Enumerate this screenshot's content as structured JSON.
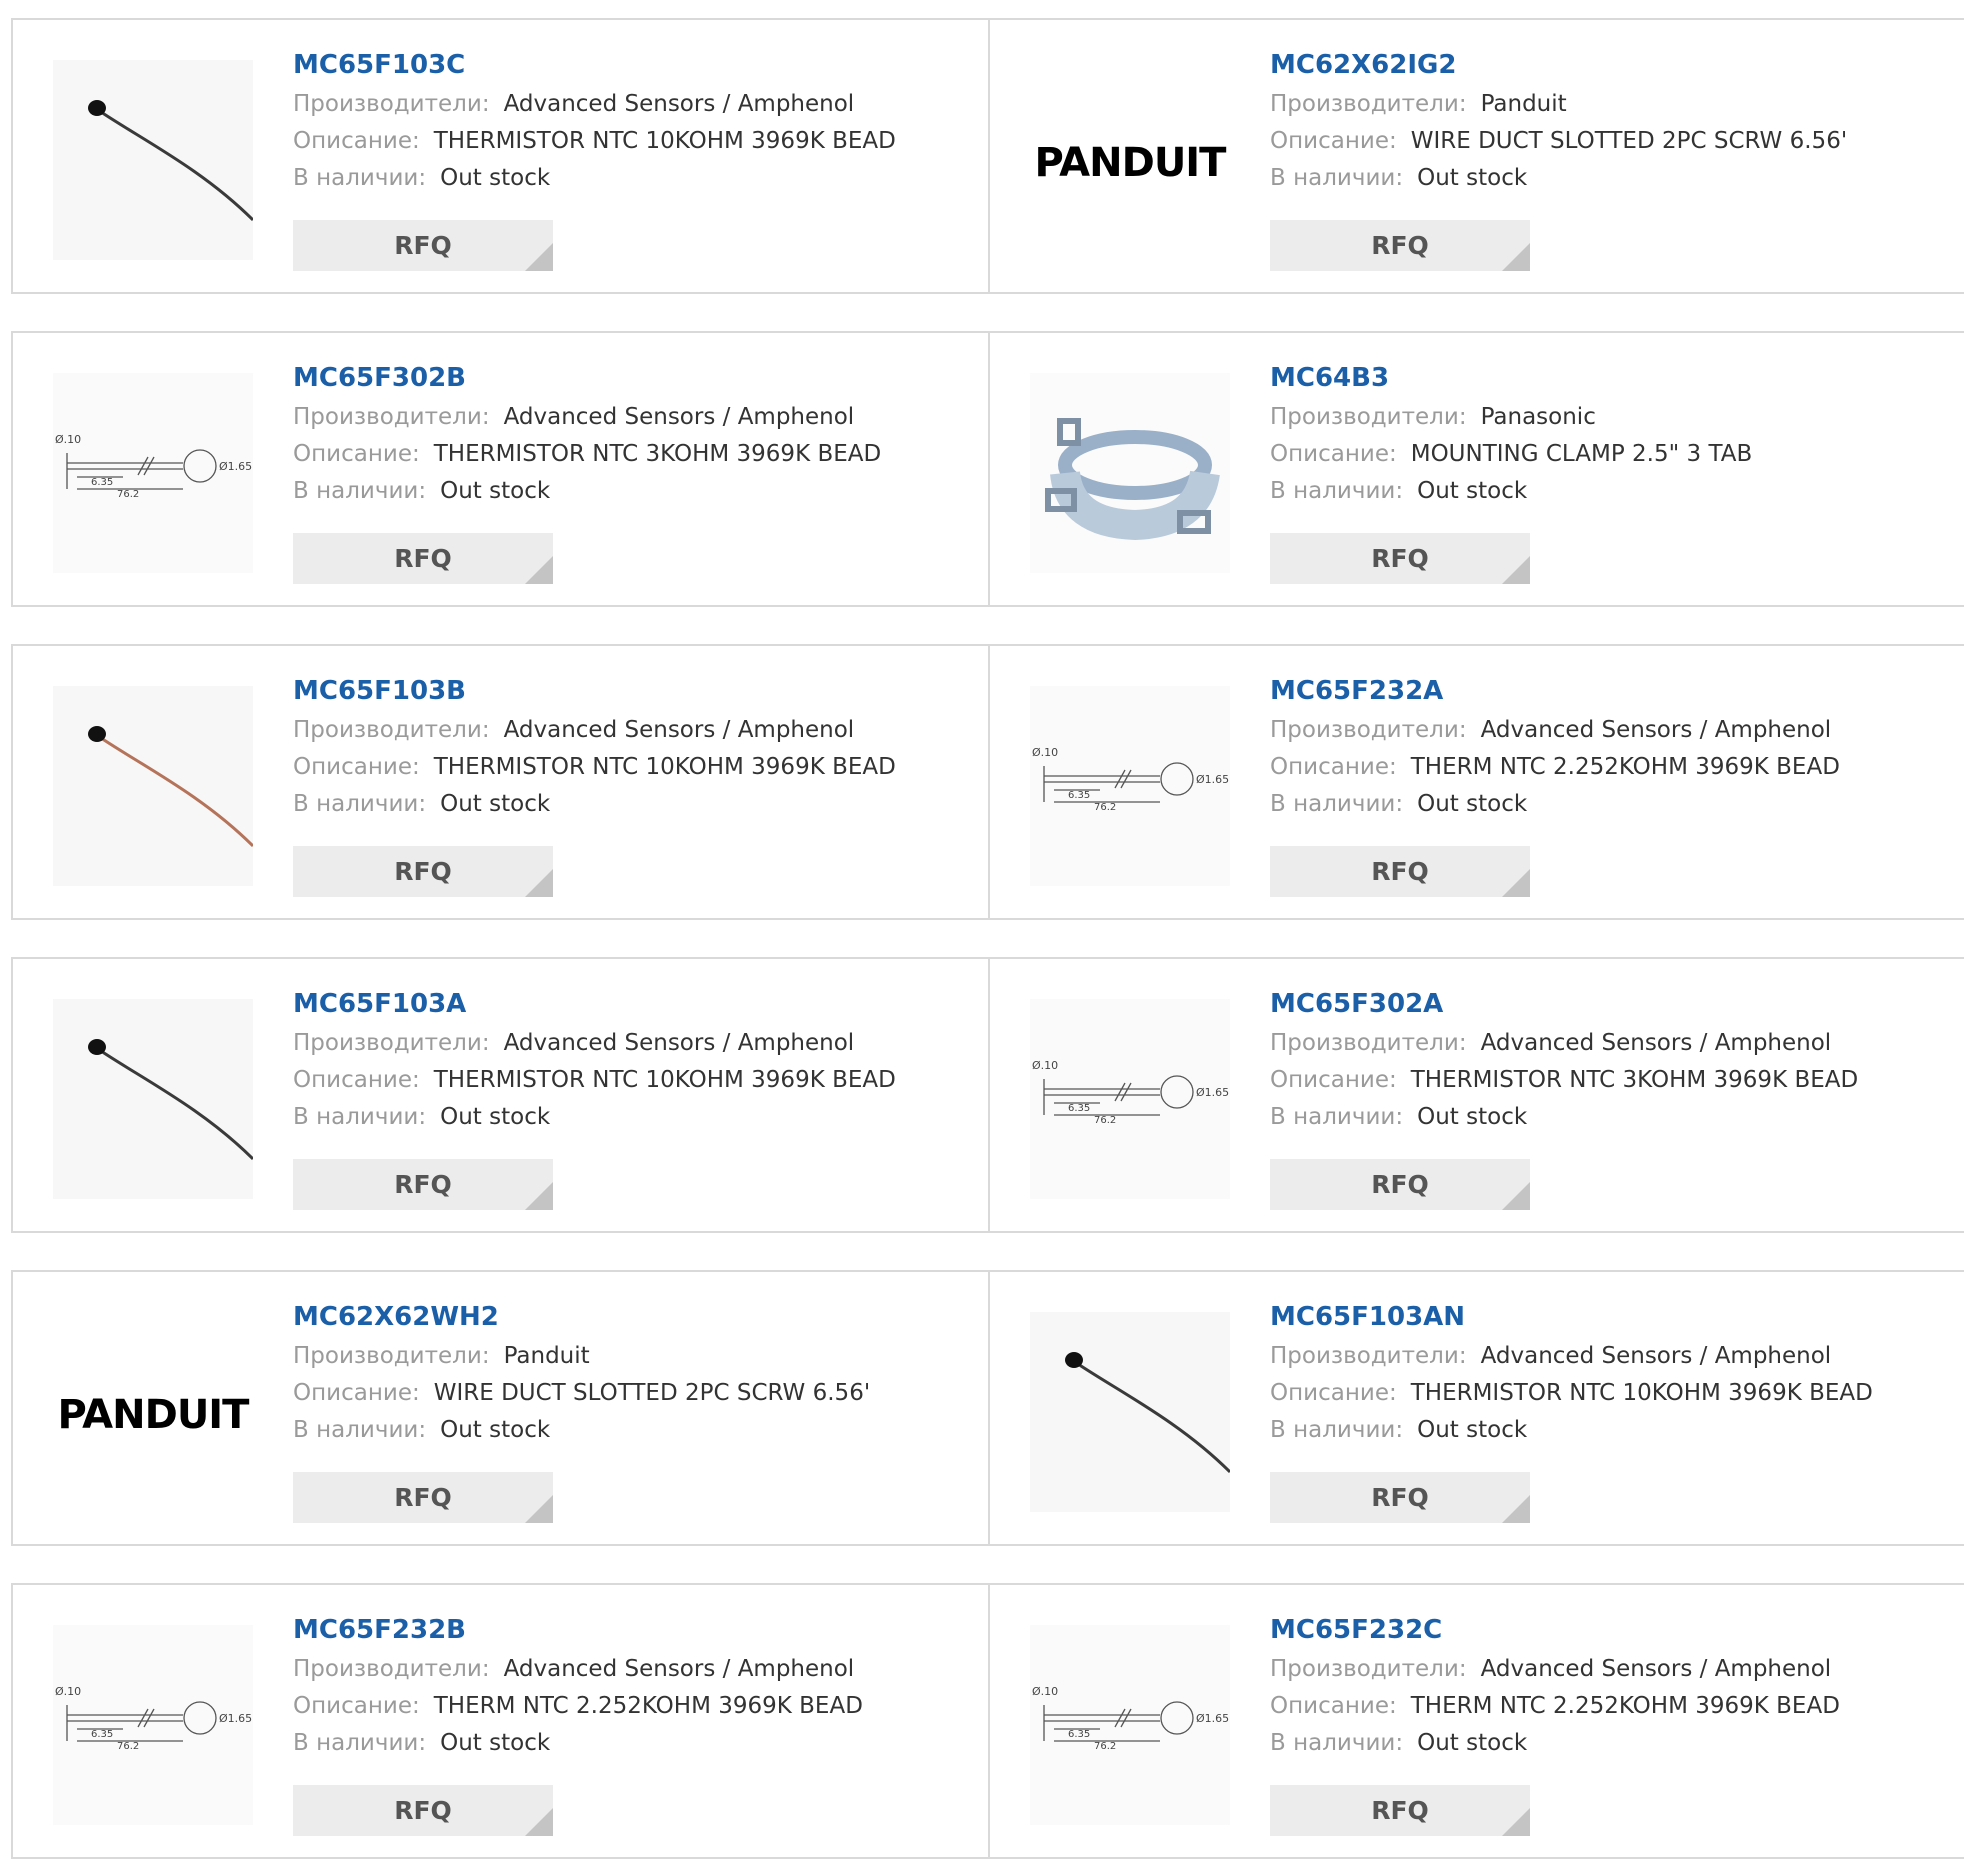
{
  "labels": {
    "manufacturer": "Производители:",
    "description": "Описание:",
    "stock": "В наличии:"
  },
  "rfq_label": "RFQ",
  "products": [
    {
      "pn": "MC65F103C",
      "manufacturer": "Advanced Sensors / Amphenol",
      "description": "THERMISTOR NTC 10KOHM 3969K BEAD",
      "stock": "Out stock",
      "image": "black-bead"
    },
    {
      "pn": "MC62X62IG2",
      "manufacturer": "Panduit",
      "description": "WIRE DUCT SLOTTED 2PC SCRW 6.56'",
      "stock": "Out stock",
      "image": "panduit-logo",
      "logo_text": "PANDUIT"
    },
    {
      "pn": "MC65F302B",
      "manufacturer": "Advanced Sensors / Amphenol",
      "description": "THERMISTOR NTC 3KOHM 3969K BEAD",
      "stock": "Out stock",
      "image": "diagram"
    },
    {
      "pn": "MC64B3",
      "manufacturer": "Panasonic",
      "description": "MOUNTING CLAMP 2.5\" 3 TAB",
      "stock": "Out stock",
      "image": "clamp"
    },
    {
      "pn": "MC65F103B",
      "manufacturer": "Advanced Sensors / Amphenol",
      "description": "THERMISTOR NTC 10KOHM 3969K BEAD",
      "stock": "Out stock",
      "image": "copper-bead"
    },
    {
      "pn": "MC65F232A",
      "manufacturer": "Advanced Sensors / Amphenol",
      "description": "THERM NTC 2.252KOHM 3969K BEAD",
      "stock": "Out stock",
      "image": "diagram"
    },
    {
      "pn": "MC65F103A",
      "manufacturer": "Advanced Sensors / Amphenol",
      "description": "THERMISTOR NTC 10KOHM 3969K BEAD",
      "stock": "Out stock",
      "image": "black-bead"
    },
    {
      "pn": "MC65F302A",
      "manufacturer": "Advanced Sensors / Amphenol",
      "description": "THERMISTOR NTC 3KOHM 3969K BEAD",
      "stock": "Out stock",
      "image": "diagram"
    },
    {
      "pn": "MC62X62WH2",
      "manufacturer": "Panduit",
      "description": "WIRE DUCT SLOTTED 2PC SCRW 6.56'",
      "stock": "Out stock",
      "image": "panduit-logo",
      "logo_text": "PANDUIT"
    },
    {
      "pn": "MC65F103AN",
      "manufacturer": "Advanced Sensors / Amphenol",
      "description": "THERMISTOR NTC 10KOHM 3969K BEAD",
      "stock": "Out stock",
      "image": "black-bead"
    },
    {
      "pn": "MC65F232B",
      "manufacturer": "Advanced Sensors / Amphenol",
      "description": "THERM NTC 2.252KOHM 3969K BEAD",
      "stock": "Out stock",
      "image": "diagram"
    },
    {
      "pn": "MC65F232C",
      "manufacturer": "Advanced Sensors / Amphenol",
      "description": "THERM NTC 2.252KOHM 3969K BEAD",
      "stock": "Out stock",
      "image": "diagram"
    }
  ],
  "diagram_text": {
    "d1": "Ø.10",
    "d2": "Ø1.65",
    "len1": "6.35",
    "len2": "76.2"
  },
  "colors": {
    "link": "#1a5fa8",
    "label": "#9a9a9a",
    "rfq_bg": "#ececec",
    "border": "#d9d9d9"
  }
}
